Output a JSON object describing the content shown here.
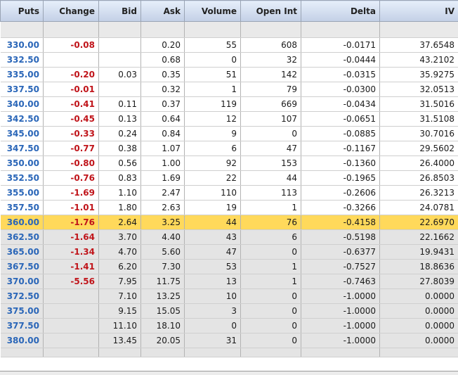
{
  "columns": {
    "puts": "Puts",
    "change": "Change",
    "bid": "Bid",
    "ask": "Ask",
    "volume": "Volume",
    "open_int": "Open Int",
    "delta": "Delta",
    "iv": "IV"
  },
  "rows": [
    {
      "strike": "330.00",
      "change": "-0.08",
      "bid": "",
      "ask": "0.20",
      "volume": "55",
      "open_int": "608",
      "delta": "-0.0171",
      "iv": "37.6548",
      "state": "otm"
    },
    {
      "strike": "332.50",
      "change": "",
      "bid": "",
      "ask": "0.68",
      "volume": "0",
      "open_int": "32",
      "delta": "-0.0444",
      "iv": "43.2102",
      "state": "otm"
    },
    {
      "strike": "335.00",
      "change": "-0.20",
      "bid": "0.03",
      "ask": "0.35",
      "volume": "51",
      "open_int": "142",
      "delta": "-0.0315",
      "iv": "35.9275",
      "state": "otm"
    },
    {
      "strike": "337.50",
      "change": "-0.01",
      "bid": "",
      "ask": "0.32",
      "volume": "1",
      "open_int": "79",
      "delta": "-0.0300",
      "iv": "32.0513",
      "state": "otm"
    },
    {
      "strike": "340.00",
      "change": "-0.41",
      "bid": "0.11",
      "ask": "0.37",
      "volume": "119",
      "open_int": "669",
      "delta": "-0.0434",
      "iv": "31.5016",
      "state": "otm"
    },
    {
      "strike": "342.50",
      "change": "-0.45",
      "bid": "0.13",
      "ask": "0.64",
      "volume": "12",
      "open_int": "107",
      "delta": "-0.0651",
      "iv": "31.5108",
      "state": "otm"
    },
    {
      "strike": "345.00",
      "change": "-0.33",
      "bid": "0.24",
      "ask": "0.84",
      "volume": "9",
      "open_int": "0",
      "delta": "-0.0885",
      "iv": "30.7016",
      "state": "otm"
    },
    {
      "strike": "347.50",
      "change": "-0.77",
      "bid": "0.38",
      "ask": "1.07",
      "volume": "6",
      "open_int": "47",
      "delta": "-0.1167",
      "iv": "29.5602",
      "state": "otm"
    },
    {
      "strike": "350.00",
      "change": "-0.80",
      "bid": "0.56",
      "ask": "1.00",
      "volume": "92",
      "open_int": "153",
      "delta": "-0.1360",
      "iv": "26.4000",
      "state": "otm"
    },
    {
      "strike": "352.50",
      "change": "-0.76",
      "bid": "0.83",
      "ask": "1.69",
      "volume": "22",
      "open_int": "44",
      "delta": "-0.1965",
      "iv": "26.8503",
      "state": "otm"
    },
    {
      "strike": "355.00",
      "change": "-1.69",
      "bid": "1.10",
      "ask": "2.47",
      "volume": "110",
      "open_int": "113",
      "delta": "-0.2606",
      "iv": "26.3213",
      "state": "otm"
    },
    {
      "strike": "357.50",
      "change": "-1.01",
      "bid": "1.80",
      "ask": "2.63",
      "volume": "19",
      "open_int": "1",
      "delta": "-0.3266",
      "iv": "24.0781",
      "state": "otm"
    },
    {
      "strike": "360.00",
      "change": "-1.76",
      "bid": "2.64",
      "ask": "3.25",
      "volume": "44",
      "open_int": "76",
      "delta": "-0.4158",
      "iv": "22.6970",
      "state": "atm"
    },
    {
      "strike": "362.50",
      "change": "-1.64",
      "bid": "3.70",
      "ask": "4.40",
      "volume": "43",
      "open_int": "6",
      "delta": "-0.5198",
      "iv": "22.1662",
      "state": "itm"
    },
    {
      "strike": "365.00",
      "change": "-1.34",
      "bid": "4.70",
      "ask": "5.60",
      "volume": "47",
      "open_int": "0",
      "delta": "-0.6377",
      "iv": "19.9431",
      "state": "itm"
    },
    {
      "strike": "367.50",
      "change": "-1.41",
      "bid": "6.20",
      "ask": "7.30",
      "volume": "53",
      "open_int": "1",
      "delta": "-0.7527",
      "iv": "18.8636",
      "state": "itm"
    },
    {
      "strike": "370.00",
      "change": "-5.56",
      "bid": "7.95",
      "ask": "11.75",
      "volume": "13",
      "open_int": "1",
      "delta": "-0.7463",
      "iv": "27.8039",
      "state": "itm"
    },
    {
      "strike": "372.50",
      "change": "",
      "bid": "7.10",
      "ask": "13.25",
      "volume": "10",
      "open_int": "0",
      "delta": "-1.0000",
      "iv": "0.0000",
      "state": "itm"
    },
    {
      "strike": "375.00",
      "change": "",
      "bid": "9.15",
      "ask": "15.05",
      "volume": "3",
      "open_int": "0",
      "delta": "-1.0000",
      "iv": "0.0000",
      "state": "itm"
    },
    {
      "strike": "377.50",
      "change": "",
      "bid": "11.10",
      "ask": "18.10",
      "volume": "0",
      "open_int": "0",
      "delta": "-1.0000",
      "iv": "0.0000",
      "state": "itm"
    },
    {
      "strike": "380.00",
      "change": "",
      "bid": "13.45",
      "ask": "20.05",
      "volume": "31",
      "open_int": "0",
      "delta": "-1.0000",
      "iv": "0.0000",
      "state": "itm"
    }
  ],
  "colors": {
    "strike": "#2a66b8",
    "change": "#c0141a",
    "atm_highlight": "#ffd95b",
    "itm_row": "#e4e4e4",
    "otm_row": "#ffffff"
  }
}
